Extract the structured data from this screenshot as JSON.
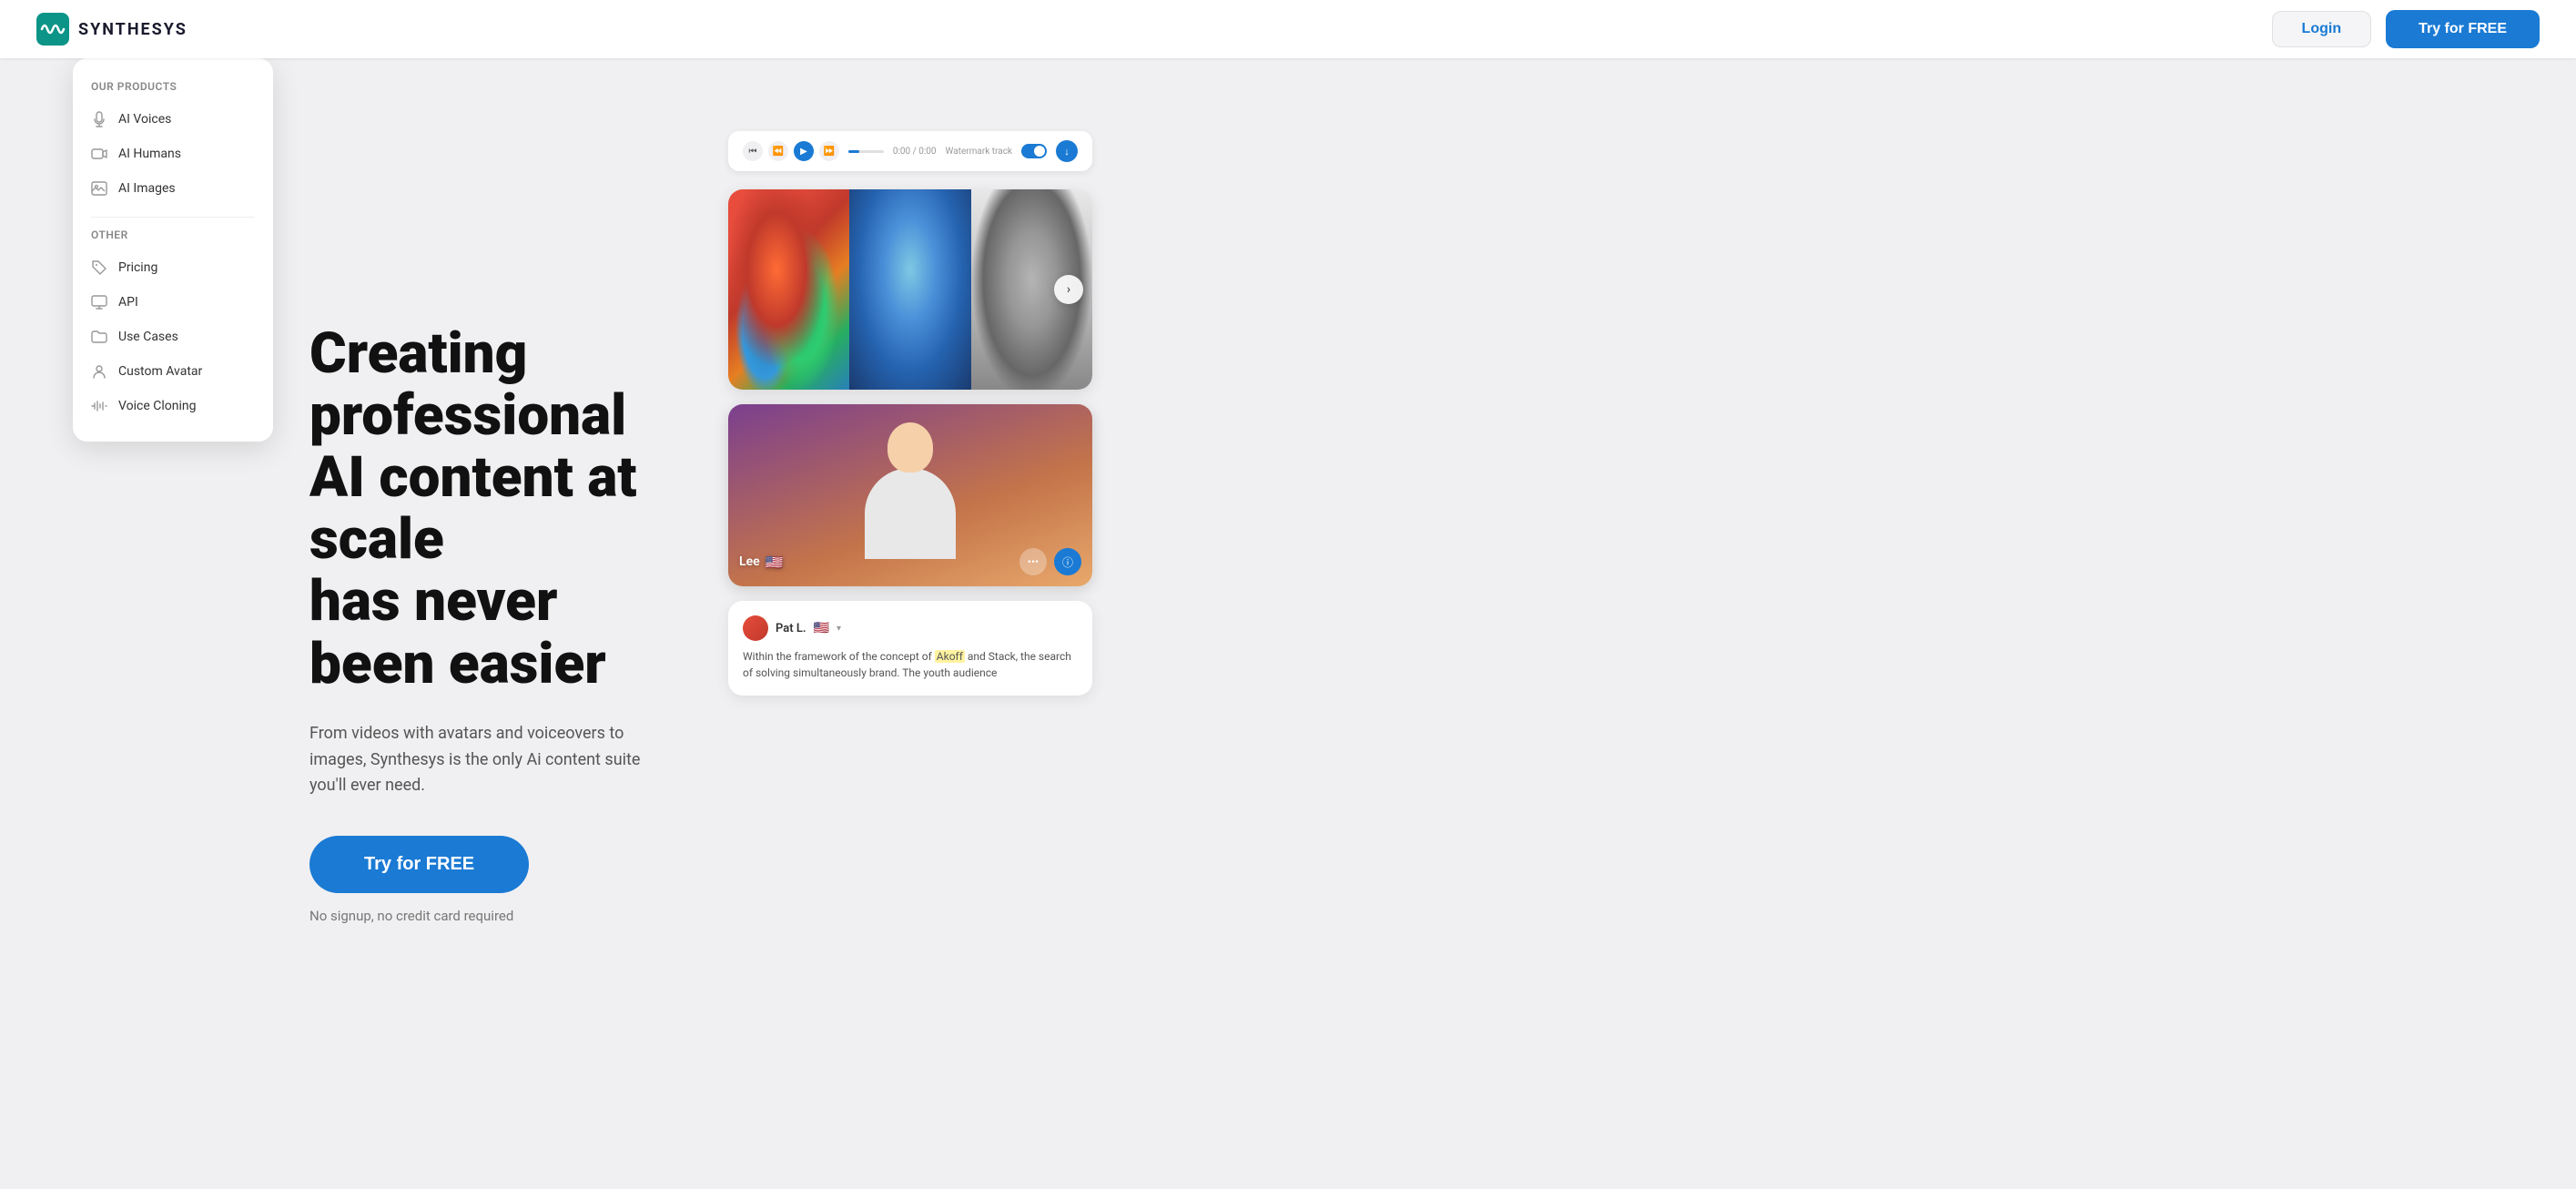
{
  "brand": {
    "logo_text": "SYNTHESYS",
    "logo_aria": "Synthesys logo"
  },
  "navbar": {
    "login_label": "Login",
    "try_free_label": "Try for FREE"
  },
  "dropdown": {
    "products_section": "Our products",
    "other_section": "Other",
    "items_products": [
      {
        "id": "ai-voices",
        "label": "AI Voices",
        "icon": "mic-icon"
      },
      {
        "id": "ai-humans",
        "label": "AI Humans",
        "icon": "video-icon"
      },
      {
        "id": "ai-images",
        "label": "AI Images",
        "icon": "image-icon"
      }
    ],
    "items_other": [
      {
        "id": "pricing",
        "label": "Pricing",
        "icon": "tag-icon"
      },
      {
        "id": "api",
        "label": "API",
        "icon": "monitor-icon"
      },
      {
        "id": "use-cases",
        "label": "Use Cases",
        "icon": "folder-icon"
      },
      {
        "id": "custom-avatar",
        "label": "Custom Avatar",
        "icon": "person-icon"
      },
      {
        "id": "voice-cloning",
        "label": "Voice Cloning",
        "icon": "waveform-icon"
      }
    ]
  },
  "hero": {
    "title_line1": "Creating professional",
    "title_line2": "AI content at scale",
    "title_line3": "has never been easier",
    "subtitle": "From videos with avatars and voiceovers to images, Synthesys is the only Ai content suite you'll ever need.",
    "cta_label": "Try for FREE",
    "no_signup": "No signup, no credit card required"
  },
  "video_bar": {
    "time": "0:00 / 0:00",
    "watermark": "Watermark track"
  },
  "pat_card": {
    "name": "Pat L.",
    "flag": "🇺🇸",
    "text": "Within the framework of the concept of Akoff and Stack, the search of solving simultaneously brand. The youth audience"
  },
  "avatar": {
    "name": "Lee",
    "flag": "🇺🇸"
  },
  "colors": {
    "accent": "#1a7ad4",
    "bg": "#f0f0f2",
    "text_dark": "#111111",
    "text_mid": "#555555"
  }
}
